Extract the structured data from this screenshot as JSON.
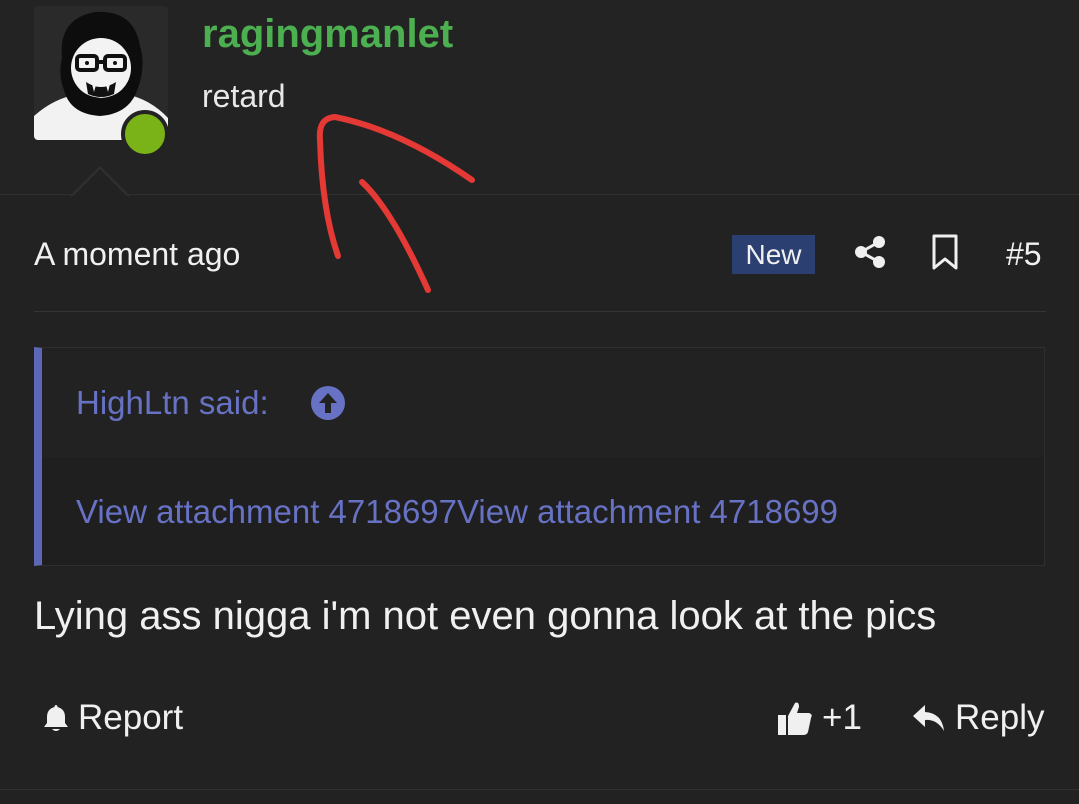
{
  "user": {
    "name": "ragingmanlet",
    "title": "retard",
    "online": true
  },
  "post": {
    "time": "A moment ago",
    "badge": "New",
    "number": "#5",
    "quote": {
      "author": "HighLtn said:",
      "content": "View attachment 4718697View attachment 4718699"
    },
    "message": "Lying ass nigga i'm not even gonna look at the pics"
  },
  "actions": {
    "report": "Report",
    "like": "+1",
    "reply": "Reply"
  },
  "colors": {
    "username": "#4caf50",
    "online": "#7ab317",
    "quote_accent": "#5c67b5",
    "badge": "#2b3f70",
    "annotation": "#e53935"
  },
  "icons": [
    "share-icon",
    "bookmark-icon",
    "arrow-up-circle-icon",
    "bell-icon",
    "thumbs-up-icon",
    "reply-icon"
  ]
}
